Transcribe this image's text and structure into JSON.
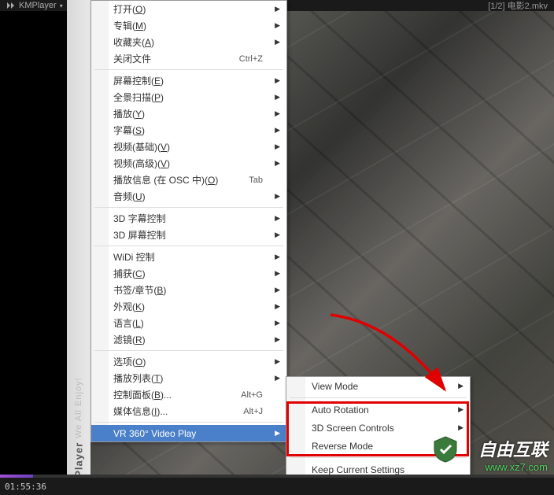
{
  "titlebar": {
    "app_name": "KMPlayer",
    "dropdown_indicator": "▾",
    "file_label": "[1/2] 电影2.mkv"
  },
  "side": {
    "brand": "KMPlayer",
    "tagline": "We All Enjoy!"
  },
  "menu": {
    "items": [
      {
        "label": "打开",
        "accel": "O",
        "arrow": true
      },
      {
        "label": "专辑",
        "accel": "M",
        "arrow": true
      },
      {
        "label": "收藏夹",
        "accel": "A",
        "arrow": true
      },
      {
        "label": "关闭文件",
        "shortcut": "Ctrl+Z"
      },
      {
        "sep": true
      },
      {
        "label": "屏幕控制",
        "accel": "E",
        "arrow": true
      },
      {
        "label": "全景扫描",
        "accel": "P",
        "arrow": true
      },
      {
        "label": "播放",
        "accel": "Y",
        "arrow": true
      },
      {
        "label": "字幕",
        "accel": "S",
        "arrow": true
      },
      {
        "label": "视频(基础)",
        "accel": "V",
        "arrow": true
      },
      {
        "label": "视频(高级)",
        "accel": "V",
        "arrow": true
      },
      {
        "label": "播放信息 (在 OSC 中)",
        "accel": "O",
        "shortcut": "Tab"
      },
      {
        "label": "音频",
        "accel": "U",
        "arrow": true
      },
      {
        "sep": true
      },
      {
        "label": "3D 字幕控制",
        "arrow": true
      },
      {
        "label": "3D 屏幕控制",
        "arrow": true
      },
      {
        "sep": true
      },
      {
        "label": "WiDi 控制",
        "arrow": true
      },
      {
        "label": "捕获",
        "accel": "C",
        "arrow": true
      },
      {
        "label": "书签/章节",
        "accel": "B",
        "arrow": true
      },
      {
        "label": "外观",
        "accel": "K",
        "arrow": true
      },
      {
        "label": "语言",
        "accel": "L",
        "arrow": true
      },
      {
        "label": "滤镜",
        "accel": "R",
        "arrow": true
      },
      {
        "sep": true
      },
      {
        "label": "选项",
        "accel": "O",
        "arrow": true
      },
      {
        "label": "播放列表",
        "accel": "T",
        "arrow": true
      },
      {
        "label": "控制面板",
        "accel": "B",
        "suffix": "...",
        "shortcut": "Alt+G"
      },
      {
        "label": "媒体信息",
        "accel": "I",
        "suffix": "...",
        "shortcut": "Alt+J"
      },
      {
        "sep": true
      },
      {
        "label": "VR 360° Video Play",
        "arrow": true,
        "highlighted": true
      }
    ]
  },
  "submenu": {
    "items": [
      {
        "label": "View Mode",
        "arrow": true
      },
      {
        "sep": true
      },
      {
        "label": "Auto Rotation",
        "arrow": true
      },
      {
        "label": "3D Screen Controls",
        "arrow": true
      },
      {
        "label": "Reverse Mode"
      },
      {
        "sep": true
      },
      {
        "label": "Keep Current Settings"
      }
    ]
  },
  "playback": {
    "current_time": "01:55:36"
  },
  "watermark": {
    "text": "自由互联",
    "url": "www.xz7.com"
  }
}
